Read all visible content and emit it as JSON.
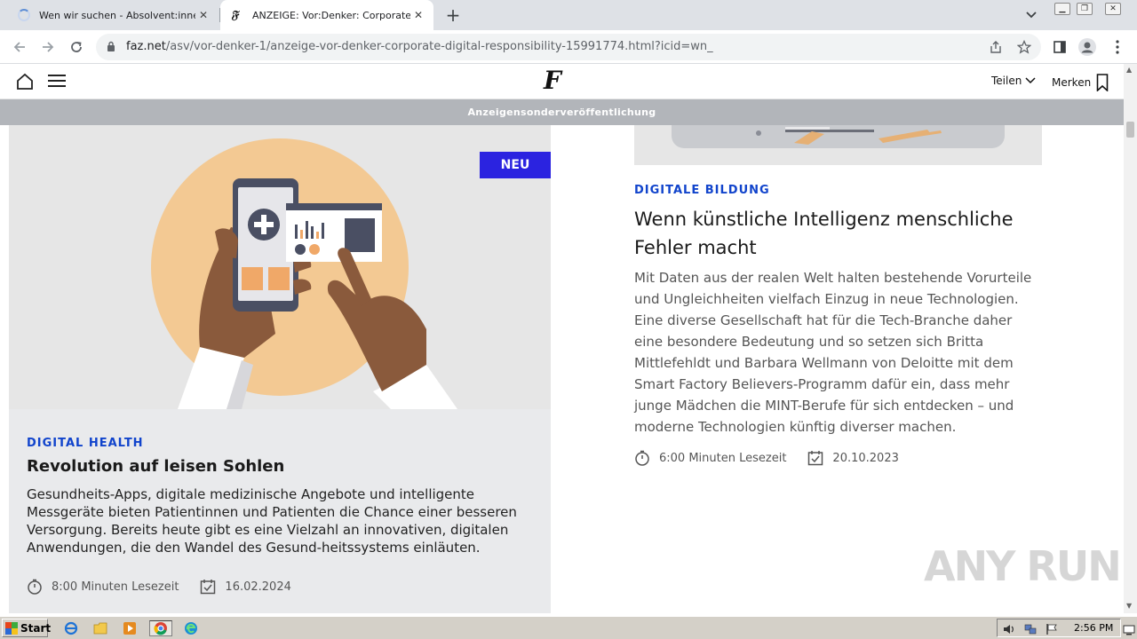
{
  "browser": {
    "tabs": [
      {
        "label": "Wen wir suchen - Absolvent:innen |"
      },
      {
        "label": "ANZEIGE: Vor:Denker: Corporate Di"
      }
    ],
    "new_tab_label": "+",
    "url": {
      "host": "faz.net",
      "path": "/asv/vor-denker-1/anzeige-vor-denker-corporate-digital-responsibility-15991774.html?icid=wn_"
    }
  },
  "site": {
    "logo": "F",
    "share_label": "Teilen",
    "bookmark_label": "Merken",
    "ad_banner": "Anzeigensonderveröffentlichung"
  },
  "articles": [
    {
      "badge": "NEU",
      "category": "DIGITAL HEALTH",
      "title": "Revolution auf leisen Sohlen",
      "teaser": "Gesundheits-Apps, digitale medizinische Angebote und intelligente Messgeräte bieten Patientinnen und Patienten die Chance einer besseren Versorgung. Bereits heute gibt es eine Vielzahl an innovativen, digitalen Anwendungen, die den Wandel des Gesund-heitssystems einläuten.",
      "reading_time": "8:00 Minuten Lesezeit",
      "date": "16.02.2024"
    },
    {
      "category": "DIGITALE BILDUNG",
      "title": "Wenn künstliche Intelligenz menschliche Fehler macht",
      "teaser": "Mit Daten aus der realen Welt halten bestehende Vorurteile und Ungleichheiten vielfach Einzug in neue Technologien. Eine diverse Gesellschaft hat für die Tech-Branche daher eine besondere Bedeutung und so setzen sich Britta Mittlefehldt und Barbara Wellmann von Deloitte mit dem Smart Factory Believers-Programm dafür ein, dass mehr junge Mädchen die MINT-Berufe für sich entdecken – und moderne Technologien künftig diverser machen.",
      "reading_time": "6:00 Minuten Lesezeit",
      "date": "20.10.2023"
    }
  ],
  "watermark": "ANY RUN",
  "taskbar": {
    "start_label": "Start",
    "clock": "2:56 PM"
  },
  "colors": {
    "category_blue": "#1144cc",
    "badge_blue": "#2b23e0",
    "ad_banner_gray": "#b2b5ba"
  }
}
